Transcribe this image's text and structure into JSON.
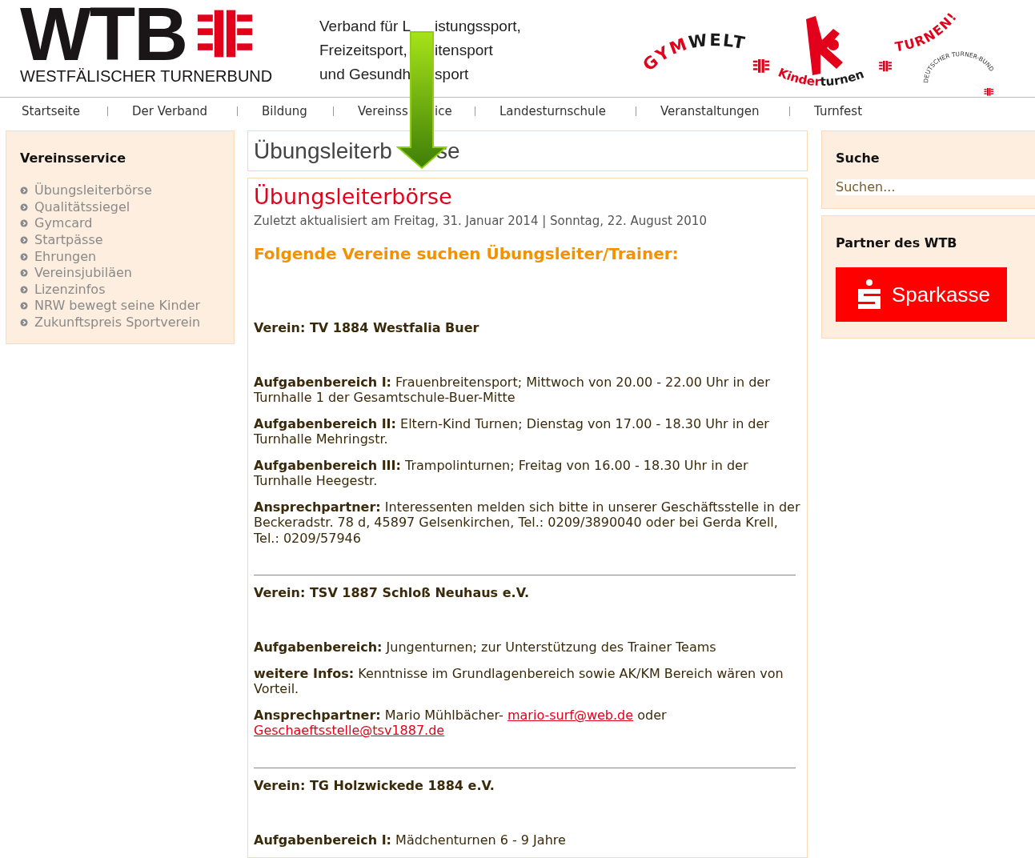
{
  "header": {
    "logo": {
      "mark": "WTB",
      "subtitle": "WESTFÄLISCHER TURNERBUND"
    },
    "tagline": [
      {
        "parts": [
          "Verband für L",
          "istungssport,"
        ]
      },
      {
        "parts": [
          "Freizeitsport,",
          "itensport"
        ]
      },
      {
        "parts": [
          "und Gesundh",
          "sport"
        ]
      }
    ],
    "brand_logos": [
      {
        "kind": "gymwelt",
        "red": "GYM",
        "black": "WELT"
      },
      {
        "kind": "kinderturnen",
        "red": "Kinder",
        "black": "turnen"
      },
      {
        "kind": "turnen",
        "red": "TURNEN!",
        "black": "DEUTSCHER TURNER-BUND"
      }
    ]
  },
  "nav": [
    {
      "parts": [
        "Startseite"
      ]
    },
    {
      "parts": [
        "Der Verband"
      ]
    },
    {
      "parts": [
        "Bildung"
      ]
    },
    {
      "parts": [
        "Vereinss",
        "ice"
      ]
    },
    {
      "parts": [
        "Landesturnschule"
      ]
    },
    {
      "parts": [
        "Veranstaltungen"
      ]
    },
    {
      "parts": [
        "Turnfest"
      ]
    }
  ],
  "left_sidebar": {
    "title": "Vereinsservice",
    "items": [
      "Übungsleiterbörse",
      "Qualitätssiegel",
      "Gymcard",
      "Startpässe",
      "Ehrungen",
      "Vereinsjubiläen",
      "Lizenzinfos",
      "NRW bewegt seine Kinder",
      "Zukunftspreis Sportverein"
    ]
  },
  "page_title": {
    "parts": [
      "Übungsleiterb",
      "se"
    ]
  },
  "article": {
    "title": "Übungsleiterbörse",
    "meta": "Zuletzt aktualisiert am Freitag, 31. Januar 2014 | Sonntag, 22. August 2010",
    "subtitle": "Folgende Vereine suchen Übungsleiter/Trainer:",
    "sections": [
      {
        "club": "Verein: TV 1884 Westfalia Buer",
        "paragraphs": [
          {
            "label": "Aufgabenbereich I:",
            "segments": [
              {
                "kind": "text",
                "text": " Frauenbreitensport; Mittwoch von 20.00 - 22.00 Uhr in der Turnhalle 1 der Gesamtschule-Buer-Mitte"
              }
            ]
          },
          {
            "label": "Aufgabenbereich II:",
            "segments": [
              {
                "kind": "text",
                "text": " Eltern-Kind Turnen; Dienstag von 17.00 - 18.30 Uhr in der Turnhalle Mehringstr."
              }
            ]
          },
          {
            "label": "Aufgabenbereich III:",
            "segments": [
              {
                "kind": "text",
                "text": " Trampolinturnen;  Freitag von 16.00 - 18.30 Uhr in der Turnhalle Heegestr."
              }
            ]
          },
          {
            "label": "Ansprechpartner:",
            "segments": [
              {
                "kind": "text",
                "text": " Interessenten melden sich bitte in unserer Geschäftsstelle in der Beckeradstr. 78 d, 45897 Gelsenkirchen, Tel.: 0209/3890040 oder bei Gerda Krell, Tel.: 0209/57946"
              }
            ]
          }
        ]
      },
      {
        "club": "Verein: TSV 1887 Schloß Neuhaus e.V.",
        "paragraphs": [
          {
            "label": "Aufgabenbereich:",
            "segments": [
              {
                "kind": "text",
                "text": " Jungenturnen; zur Unterstützung des Trainer Teams"
              }
            ]
          },
          {
            "label": "weitere Infos:",
            "segments": [
              {
                "kind": "text",
                "text": " Kenntnisse im Grundlagenbereich sowie AK/KM Bereich wären von Vorteil."
              }
            ]
          },
          {
            "label": "Ansprechpartner:",
            "segments": [
              {
                "kind": "text",
                "text": " Mario Mühlbächer- "
              },
              {
                "kind": "link",
                "text": "mario-surf@web.de"
              },
              {
                "kind": "text",
                "text": " oder "
              },
              {
                "kind": "link",
                "text": "Geschaeftsstelle@tsv1887.de"
              }
            ]
          }
        ]
      },
      {
        "club": "Verein: TG Holzwickede 1884 e.V.",
        "paragraphs": [
          {
            "label": "Aufgabenbereich I:",
            "segments": [
              {
                "kind": "text",
                "text": " Mädchenturnen 6 - 9 Jahre"
              }
            ]
          }
        ]
      }
    ]
  },
  "right_sidebar": {
    "search": {
      "title": "Suche",
      "placeholder": "Suchen..."
    },
    "partner": {
      "title": "Partner des WTB",
      "logo_text": "Sparkasse"
    }
  }
}
